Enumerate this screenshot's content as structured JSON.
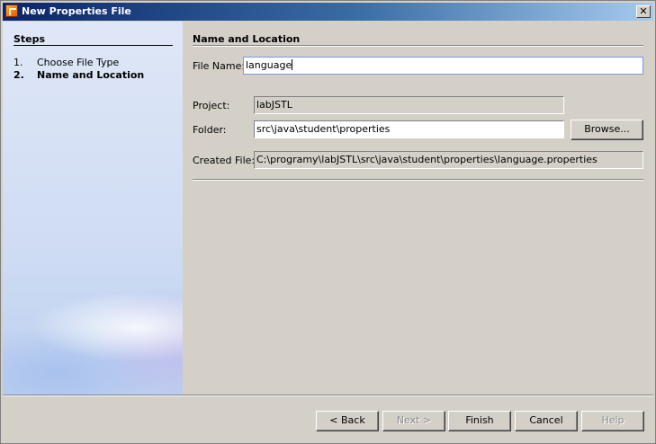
{
  "window": {
    "title": "New Properties File",
    "close_label": "✕"
  },
  "steps": {
    "title": "Steps",
    "items": [
      {
        "num": "1.",
        "label": "Choose File Type"
      },
      {
        "num": "2.",
        "label": "Name and Location"
      }
    ]
  },
  "main": {
    "section_title": "Name and Location",
    "file_name": {
      "label": "File Name:",
      "value": "language"
    },
    "project": {
      "label": "Project:",
      "value": "labJSTL"
    },
    "folder": {
      "label": "Folder:",
      "value": "src\\java\\student\\properties",
      "browse_label": "Browse..."
    },
    "created_file": {
      "label": "Created File:",
      "value": "C:\\programy\\labJSTL\\src\\java\\student\\properties\\language.properties"
    }
  },
  "footer": {
    "back_label": "< Back",
    "next_label": "Next >",
    "finish_label": "Finish",
    "cancel_label": "Cancel",
    "help_label": "Help"
  }
}
